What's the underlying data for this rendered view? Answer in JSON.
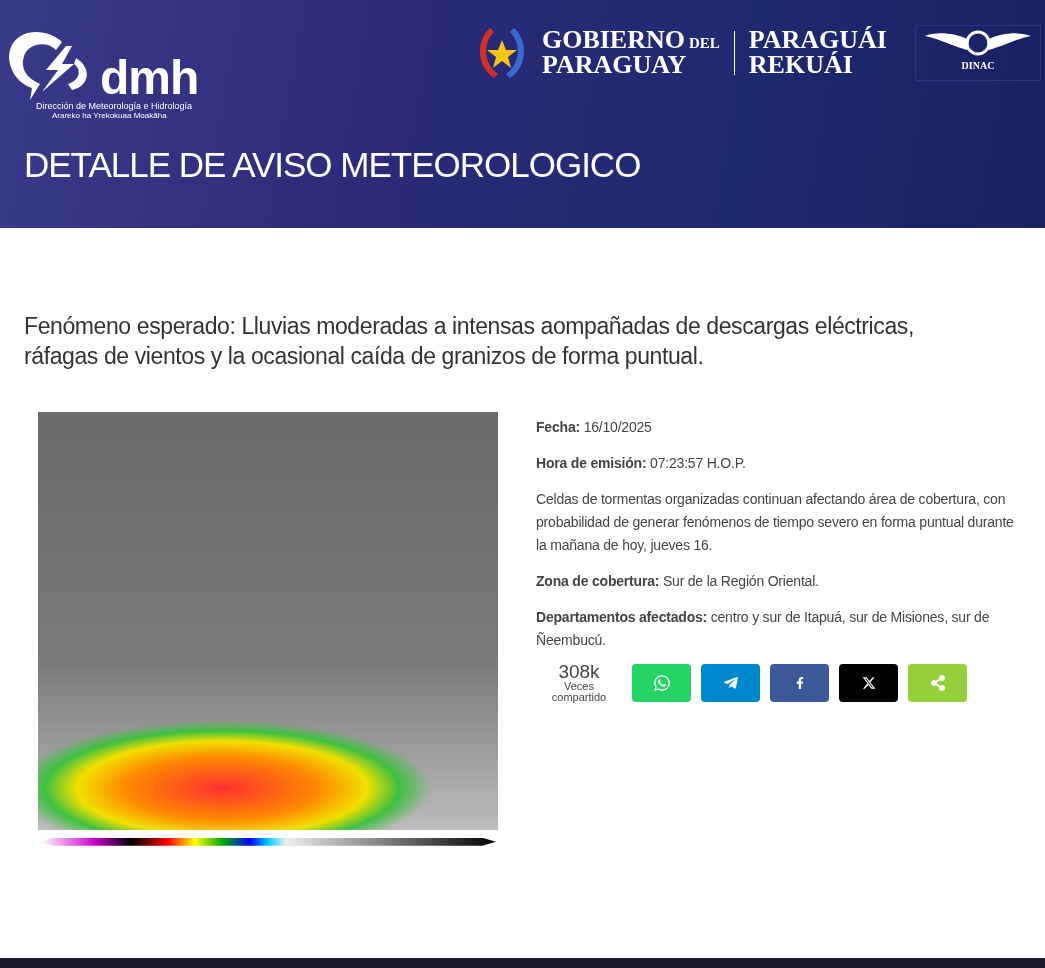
{
  "header": {
    "logo": {
      "mark": "dmh",
      "line_1": "Dirección de Meteorología e Hidrología",
      "line_2": "Arareko ha Yrekokuaa Moakãha"
    },
    "government": {
      "line_1": "GOBIERNO",
      "line_1_small": "DEL",
      "line_2": "PARAGUAY",
      "motto_1": "PARAGUÁI",
      "motto_2": "REKUÁI"
    },
    "agency": "DINAC",
    "title": "DETALLE DE AVISO METEOROLOGICO"
  },
  "phenomenon": "Fenómeno esperado: Lluvias moderadas a intensas aompañadas de descargas eléctricas, ráfagas de vientos y la ocasional caída de granizos de forma puntual.",
  "details": [
    {
      "label": "Fecha:",
      "value": "16/10/2025"
    },
    {
      "label": "Hora de emisión:",
      "value": "07:23:57 H.O.P."
    },
    {
      "value": "Celdas de tormentas organizadas continuan afectando área de cobertura, con probabilidad de generar fenómenos de tiempo severo en forma puntual durante la mañana de hoy, jueves 16."
    },
    {
      "label": "Zona de cobertura:",
      "value": "Sur de la Región Oriental."
    },
    {
      "label": "Departamentos afectados:",
      "value": "centro y sur de Itapuá, sur de Misiones, sur de Ñeembucú."
    }
  ],
  "shares": {
    "count": "308k",
    "caption": "Veces compartido",
    "buttons": [
      {
        "kind": "whatsapp",
        "color": "#25d366"
      },
      {
        "kind": "telegram",
        "color": "#0088cc"
      },
      {
        "kind": "facebook",
        "color": "#3b5998"
      },
      {
        "kind": "x",
        "color": "#000000"
      },
      {
        "kind": "share",
        "color": "#95d03a"
      }
    ]
  }
}
